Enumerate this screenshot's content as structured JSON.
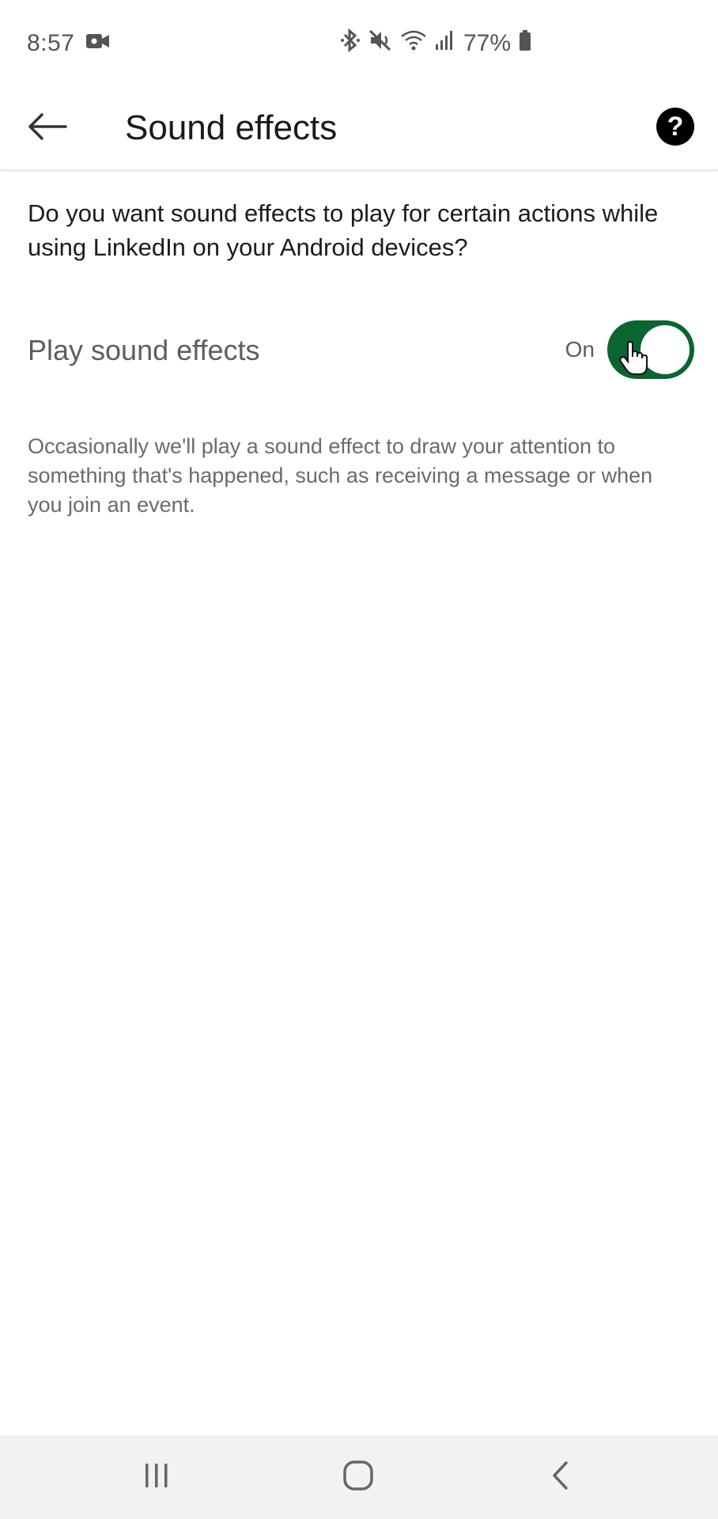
{
  "status_bar": {
    "time": "8:57",
    "battery": "77%",
    "icons": [
      "video-camera-icon",
      "bluetooth-icon",
      "mute-icon",
      "wifi-icon",
      "signal-icon",
      "battery-icon"
    ]
  },
  "app_bar": {
    "title": "Sound effects",
    "back_icon": "back-arrow-icon",
    "help_icon": "help-icon",
    "help_glyph": "?"
  },
  "content": {
    "question": "Do you want sound effects to play for certain actions while using LinkedIn on your Android devices?",
    "setting": {
      "label": "Play sound effects",
      "state_label": "On",
      "enabled": true
    },
    "description": "Occasionally we'll play a sound effect to draw your attention to something that's happened, such as receiving a message or when you join an event."
  },
  "nav_bar": {
    "icons": [
      "recent-apps-icon",
      "home-icon",
      "back-icon"
    ]
  },
  "colors": {
    "toggle_on": "#0a6530",
    "text_primary": "#1c1c1c",
    "text_secondary": "#5e5e5e",
    "nav_background": "#f2f2f2"
  }
}
